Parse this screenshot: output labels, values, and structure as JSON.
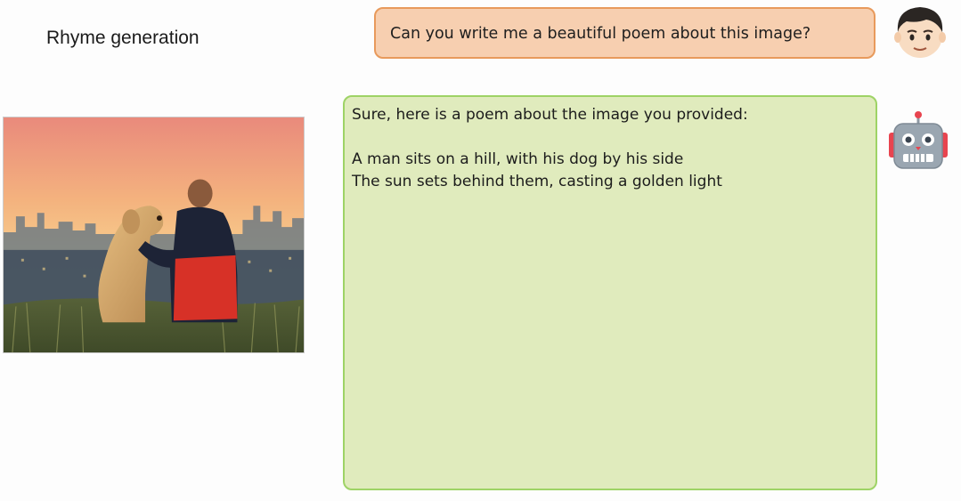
{
  "page": {
    "title": "Rhyme generation"
  },
  "chat": {
    "user_message": "Can you write me a beautiful poem about this image?",
    "bot_intro": "Sure, here is a poem about the image you provided:",
    "bot_poem_lines": [
      "A man sits on a hill, with his dog by his side",
      "The sun sets behind them, casting a golden light"
    ]
  },
  "icons": {
    "user_avatar": "boy-face-icon",
    "bot_avatar": "robot-face-icon"
  },
  "colors": {
    "user_bubble_bg": "#f7cfb0",
    "user_bubble_border": "#e89a5c",
    "bot_bubble_bg": "#e0ebbd",
    "bot_bubble_border": "#9ed366"
  }
}
